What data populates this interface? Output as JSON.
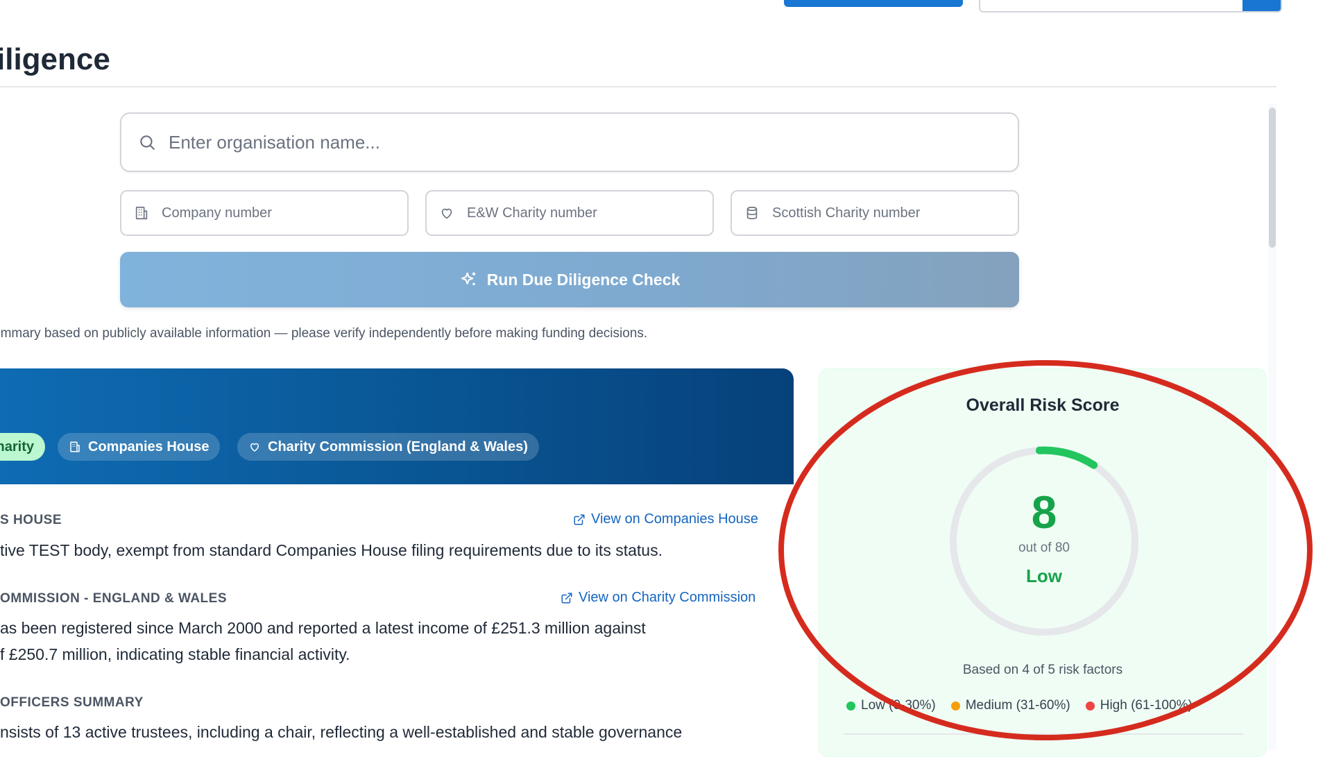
{
  "page": {
    "title": "iligence"
  },
  "search": {
    "org_placeholder": "Enter organisation name...",
    "company_placeholder": "Company number",
    "charity_ew_placeholder": "E&W Charity number",
    "charity_scot_placeholder": "Scottish Charity number",
    "run_button": "Run Due Diligence Check"
  },
  "disclaimer": "ummary based on publicly available information — please verify independently before making funding decisions.",
  "banner": {
    "tags": [
      "harity",
      "Companies House",
      "Charity Commission (England & Wales)"
    ]
  },
  "sections": [
    {
      "heading": "S HOUSE",
      "link": "View on Companies House",
      "lines": [
        "tive TEST body, exempt from standard Companies House filing requirements due to its status."
      ]
    },
    {
      "heading": "OMMISSION - ENGLAND & WALES",
      "link": "View on Charity Commission",
      "lines": [
        "as been registered since March 2000 and reported a latest income of £251.3 million against",
        "f £250.7 million, indicating stable financial activity."
      ]
    },
    {
      "heading": "OFFICERS SUMMARY",
      "lines": [
        "nsists of 13 active trustees, including a chair, reflecting a well-established and stable governance"
      ]
    }
  ],
  "risk": {
    "title": "Overall Risk Score",
    "score": "8",
    "max_text": "out of 80",
    "score_value": 8,
    "score_max": 80,
    "level": "Low",
    "based_on": "Based on 4 of 5 risk factors",
    "legend": [
      {
        "label": "Low (0-30%)",
        "color": "#22c55e"
      },
      {
        "label": "Medium (31-60%)",
        "color": "#f59e0b"
      },
      {
        "label": "High (61-100%)",
        "color": "#ef4444"
      }
    ],
    "gauge_color": "#22c55e",
    "track_color": "#e5e7eb"
  },
  "annotation": {
    "color": "#d52b1e"
  }
}
